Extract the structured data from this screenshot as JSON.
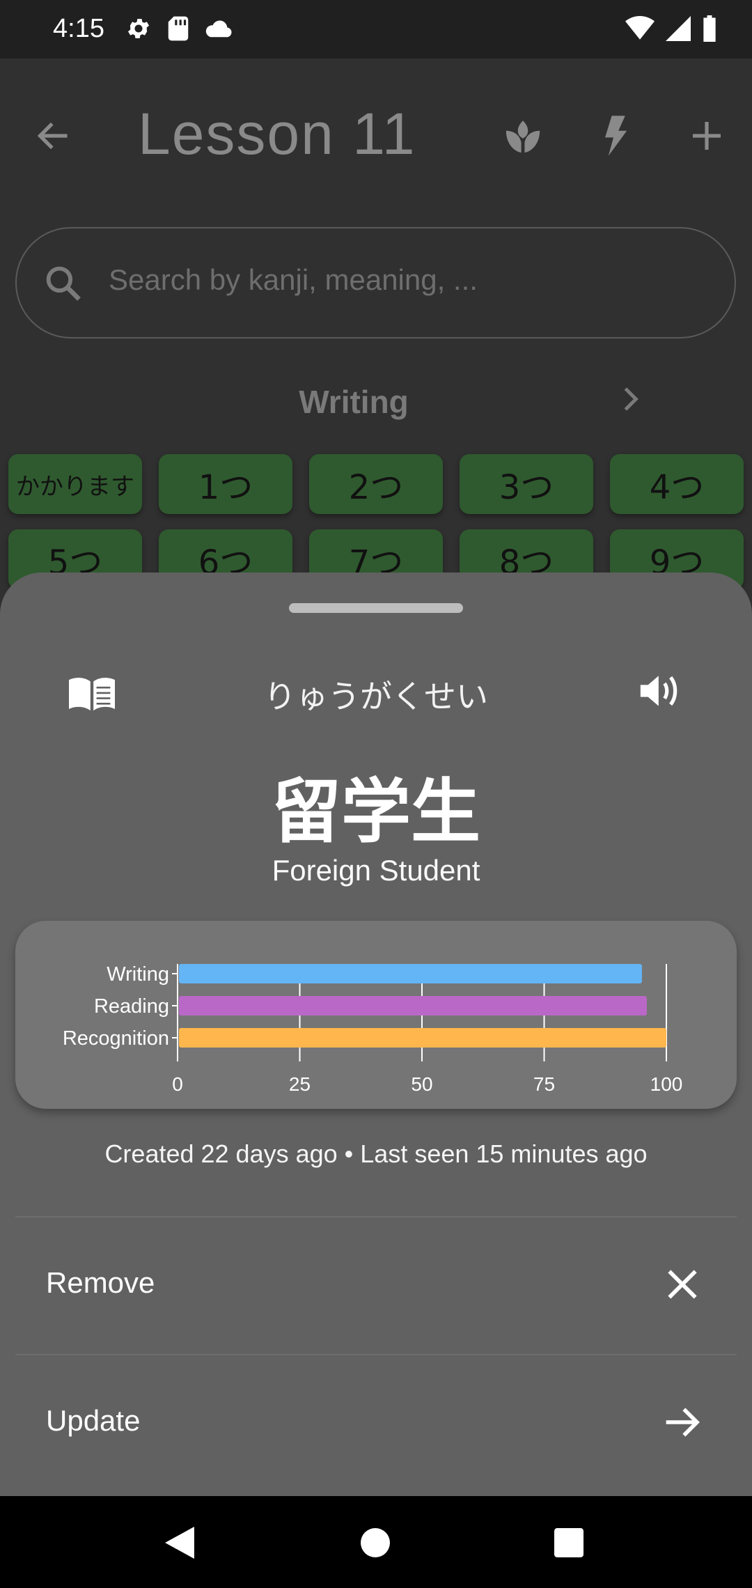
{
  "status_bar": {
    "time": "4:15",
    "left_icons": [
      "gear-icon",
      "sd-card-icon",
      "cloud-icon"
    ],
    "right_icons": [
      "wifi-icon",
      "signal-icon",
      "battery-icon"
    ]
  },
  "app_bar": {
    "title": "Lesson 11",
    "actions": [
      "back-arrow-icon",
      "sprout-icon",
      "lightning-icon",
      "plus-icon"
    ]
  },
  "search": {
    "placeholder": "Search by kanji, meaning, ..."
  },
  "section": {
    "title": "Writing"
  },
  "chips": [
    "かかります",
    "1つ",
    "2つ",
    "3つ",
    "4つ",
    "5つ",
    "6つ",
    "7つ",
    "8つ",
    "9つ"
  ],
  "sheet": {
    "reading": "りゅうがくせい",
    "kanji": "留学生",
    "meaning": "Foreign Student",
    "timestamps": "Created 22 days ago • Last seen 15 minutes ago",
    "actions": [
      {
        "label": "Remove",
        "icon": "close-icon"
      },
      {
        "label": "Update",
        "icon": "arrow-right-icon"
      }
    ]
  },
  "chart_data": {
    "type": "bar",
    "orientation": "horizontal",
    "categories": [
      "Writing",
      "Reading",
      "Recognition"
    ],
    "values": [
      95,
      96,
      100
    ],
    "colors": [
      "#64b5f6",
      "#ba68c8",
      "#ffb74d"
    ],
    "xticks": [
      0,
      25,
      50,
      75,
      100
    ],
    "xlim": [
      0,
      100
    ],
    "grid": true
  },
  "colors": {
    "chip_bg": "#2f5a2f",
    "sheet_bg": "#616161",
    "app_bg": "#303030"
  }
}
